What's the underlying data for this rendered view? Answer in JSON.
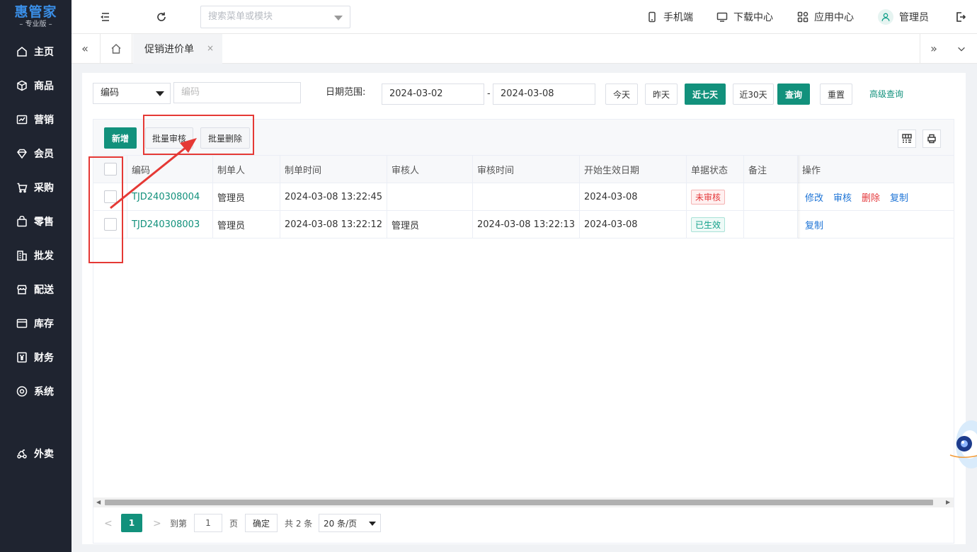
{
  "brand": {
    "name": "惠管家",
    "sub": "– 专业版 –"
  },
  "sidebar": {
    "items": [
      {
        "label": "主页",
        "icon": "home-icon"
      },
      {
        "label": "商品",
        "icon": "box-icon"
      },
      {
        "label": "营销",
        "icon": "chart-icon"
      },
      {
        "label": "会员",
        "icon": "diamond-icon"
      },
      {
        "label": "采购",
        "icon": "cart-icon"
      },
      {
        "label": "零售",
        "icon": "bag-icon"
      },
      {
        "label": "批发",
        "icon": "building-icon"
      },
      {
        "label": "配送",
        "icon": "store-icon"
      },
      {
        "label": "库存",
        "icon": "warehouse-icon"
      },
      {
        "label": "财务",
        "icon": "yen-icon"
      },
      {
        "label": "系统",
        "icon": "settings-icon"
      },
      {
        "label": "外卖",
        "icon": "delivery-icon"
      }
    ]
  },
  "topbar": {
    "search_placeholder": "搜索菜单或模块",
    "mobile": "手机端",
    "download": "下载中心",
    "apps": "应用中心",
    "user": "管理员"
  },
  "tabs": {
    "active": "促销进价单",
    "close": "×"
  },
  "filters": {
    "field_select": "编码",
    "field_placeholder": "编码",
    "date_label": "日期范围:",
    "date_start": "2024-03-02",
    "date_sep": "-",
    "date_end": "2024-03-08",
    "today": "今天",
    "yesterday": "昨天",
    "last7": "近七天",
    "last30": "近30天",
    "query": "查询",
    "reset": "重置",
    "advanced": "高级查询"
  },
  "toolbar": {
    "new": "新增",
    "batch_audit": "批量审核",
    "batch_delete": "批量删除"
  },
  "table": {
    "columns": [
      "编码",
      "制单人",
      "制单时间",
      "审核人",
      "审核时间",
      "开始生效日期",
      "单据状态",
      "备注",
      "操作"
    ],
    "rows": [
      {
        "code": "TJD240308004",
        "creator": "管理员",
        "created_at": "2024-03-08 13:22:45",
        "auditor": "",
        "audited_at": "",
        "start_date": "2024-03-08",
        "status": "未审核",
        "status_color": "#e4393c",
        "remark": "",
        "actions": [
          "修改",
          "审核",
          "删除",
          "复制"
        ]
      },
      {
        "code": "TJD240308003",
        "creator": "管理员",
        "created_at": "2024-03-08 13:22:12",
        "auditor": "管理员",
        "audited_at": "2024-03-08 13:22:13",
        "start_date": "2024-03-08",
        "status": "已生效",
        "status_color": "#12a08a",
        "remark": "",
        "actions": [
          "复制"
        ]
      }
    ]
  },
  "pagination": {
    "prev": "<",
    "current": "1",
    "next": ">",
    "goto_label": "到第",
    "goto_value": "1",
    "page_unit": "页",
    "confirm": "确定",
    "total": "共 2 条",
    "page_size": "20 条/页"
  },
  "colors": {
    "primary": "#12917c",
    "sidebar_bg": "#1f2430",
    "annotation": "#e53935"
  }
}
